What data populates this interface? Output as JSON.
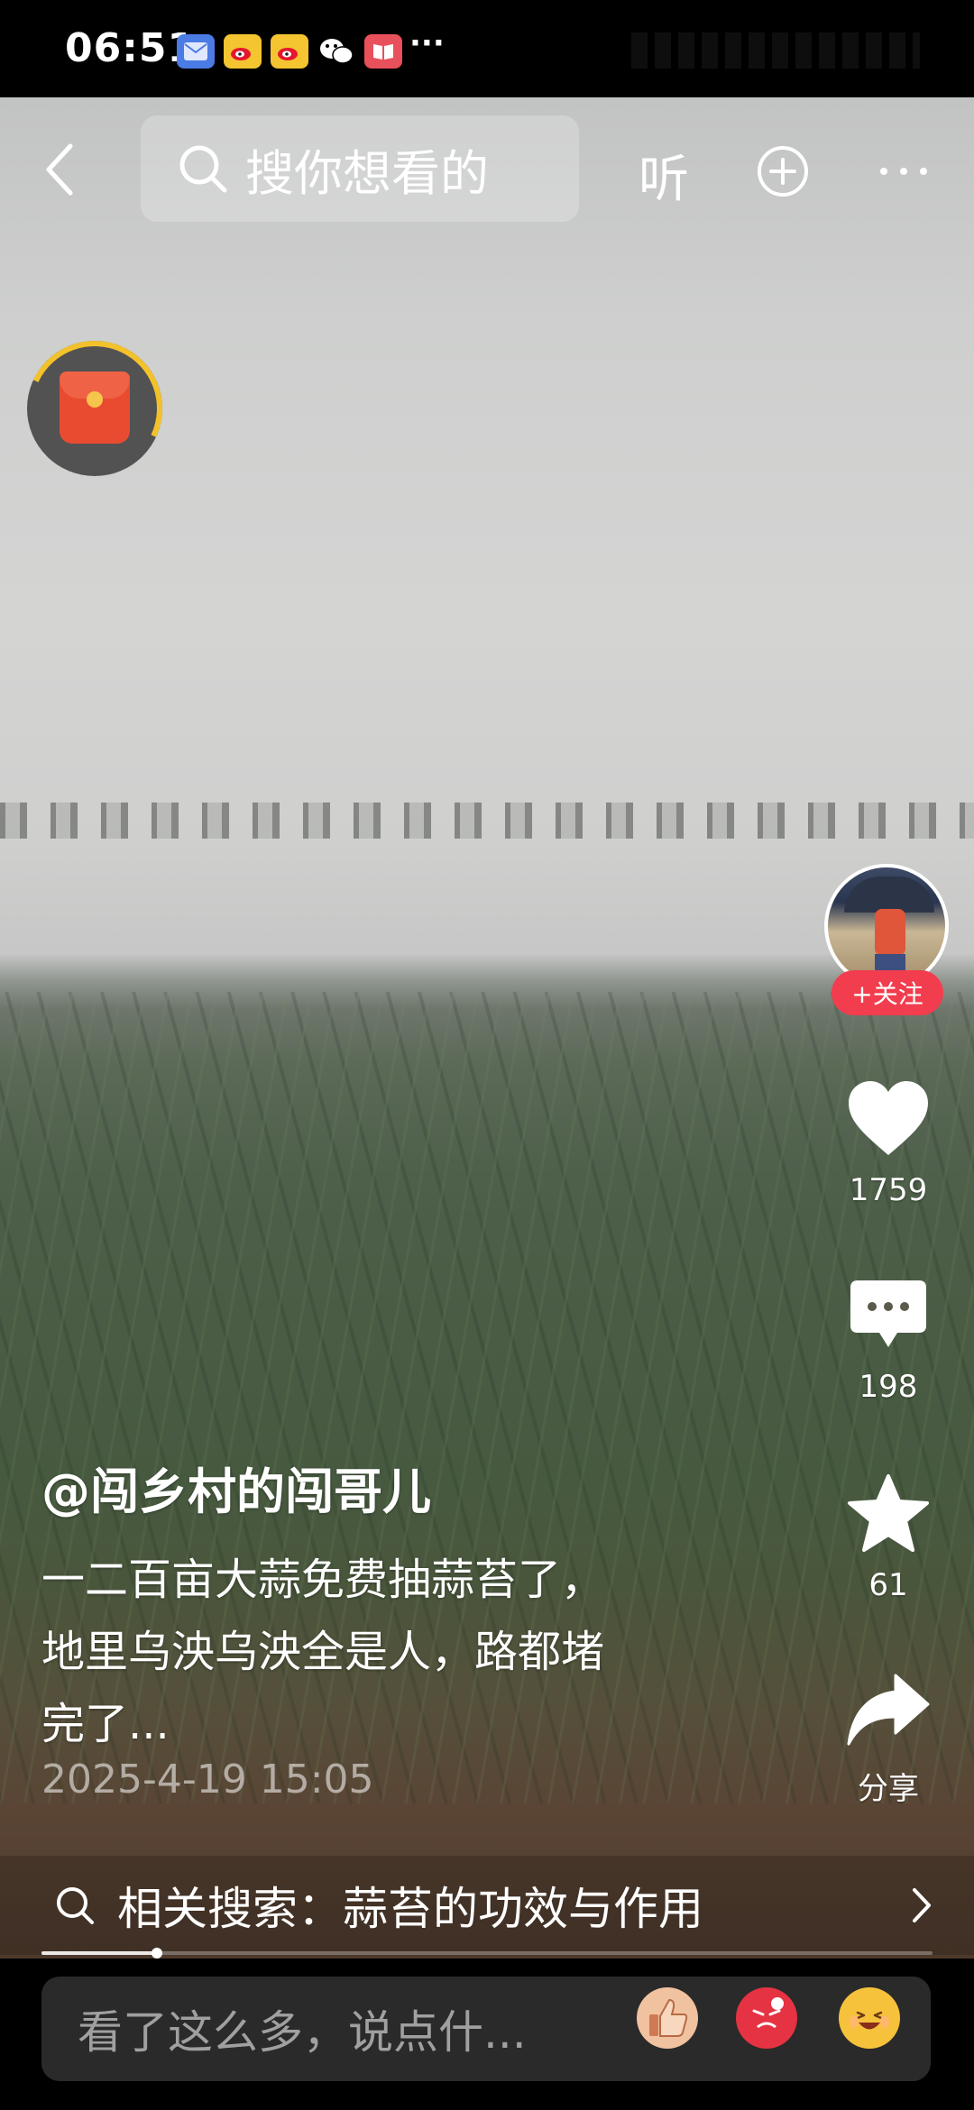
{
  "status_bar": {
    "time": "06:51",
    "more": "···",
    "icons": [
      "mail-app-icon",
      "weibo-icon",
      "weibo-icon",
      "wechat-icon",
      "book-app-icon"
    ]
  },
  "top_bar": {
    "search_placeholder": "搜你想看的",
    "listen_label": "听"
  },
  "creator": {
    "follow_label": "+关注"
  },
  "actions": {
    "likes": "1759",
    "comments": "198",
    "favorites": "61",
    "share_label": "分享"
  },
  "caption": {
    "author": "@闯乡村的闯哥儿",
    "lines": [
      "一二百亩大蒜免费抽蒜苔了，",
      "地里乌泱乌泱全是人，路都堵",
      "完了..."
    ],
    "date": "2025-4-19 15:05"
  },
  "related_search": {
    "text": "相关搜索：蒜苔的功效与作用"
  },
  "playback": {
    "progress": 0.13
  },
  "comment_bar": {
    "placeholder": "看了这么多，说点什..."
  },
  "colors": {
    "follow_red": "#f23d4e",
    "packet_red": "#e94b31",
    "ring_gold": "#f3c22b"
  }
}
